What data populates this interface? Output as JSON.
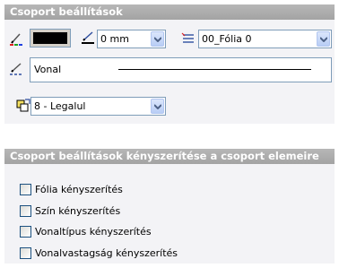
{
  "section1": {
    "title": "Csoport beállítások",
    "color": "#000000",
    "lineweight": "0 mm",
    "layer": "00_Fólia 0",
    "linetype": "Vonal",
    "draw_order": "8 - Legalul"
  },
  "section2": {
    "title": "Csoport beállítások kényszerítése a csoport elemeire",
    "checkboxes": [
      {
        "label": "Fólia kényszerítés",
        "checked": false
      },
      {
        "label": "Szín kényszerítés",
        "checked": false
      },
      {
        "label": "Vonaltípus kényszerítés",
        "checked": false
      },
      {
        "label": "Vonalvastagság kényszerítés",
        "checked": false
      }
    ]
  },
  "colors": {
    "header_bg": "#a9a9a9",
    "panel_bg": "#f3f3f6",
    "border": "#7f9db9"
  }
}
